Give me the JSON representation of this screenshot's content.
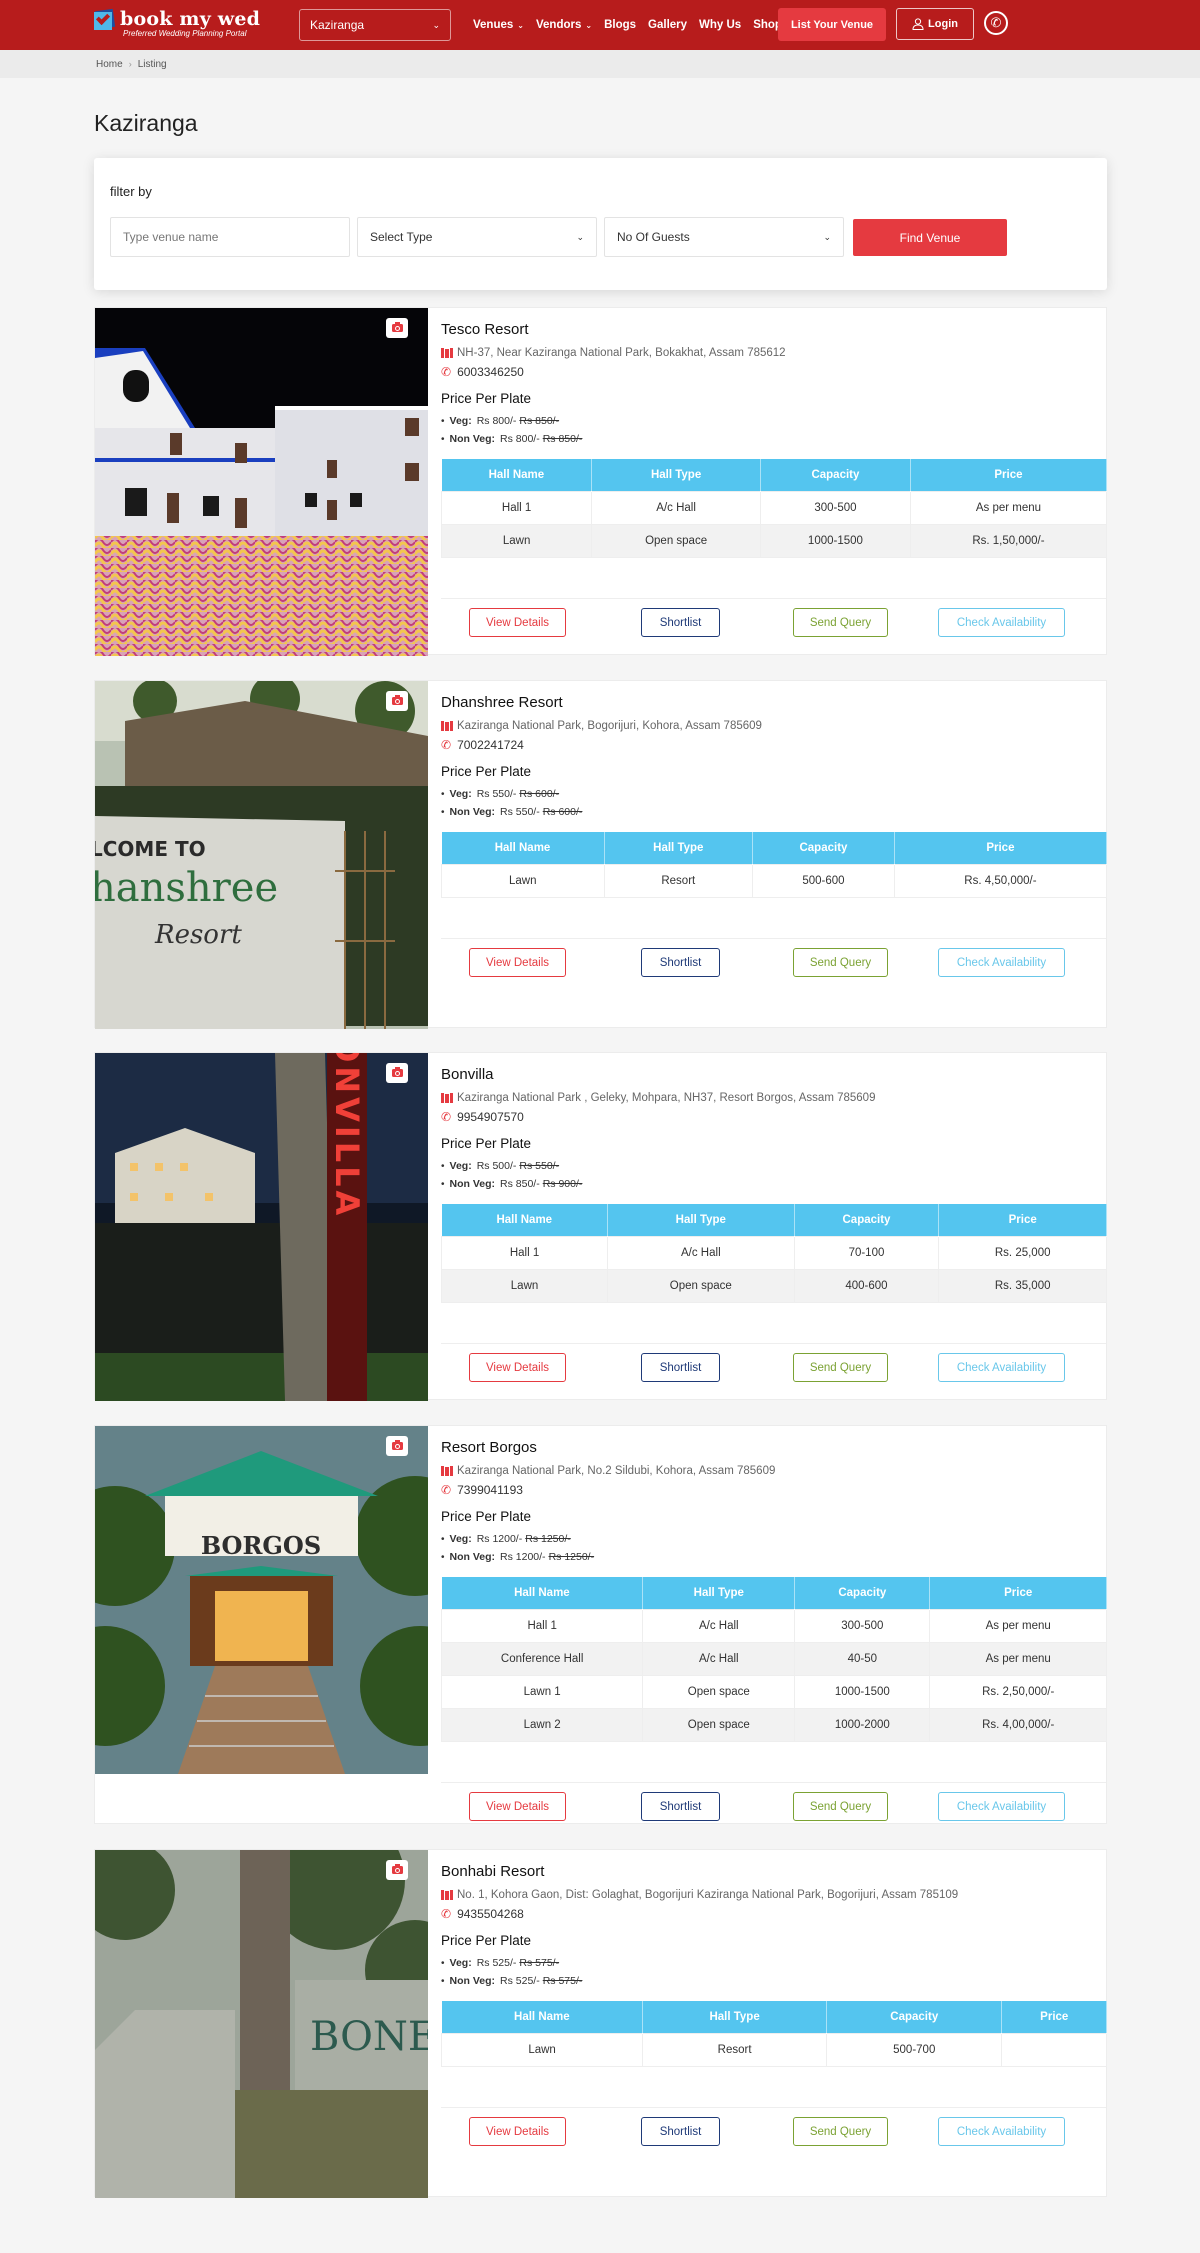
{
  "header": {
    "logo_title": "book my wed",
    "logo_tagline": "Preferred Wedding Planning Portal",
    "city_select": "Kaziranga",
    "nav": [
      {
        "label": "Venues",
        "dropdown": true
      },
      {
        "label": "Vendors",
        "dropdown": true
      },
      {
        "label": "Blogs",
        "dropdown": false
      },
      {
        "label": "Gallery",
        "dropdown": false
      },
      {
        "label": "Why Us",
        "dropdown": false
      },
      {
        "label": "Shop",
        "dropdown": false
      }
    ],
    "list_venue_label": "List Your Venue",
    "login_label": "Login",
    "icons": {
      "login": "user-icon",
      "phone": "phone-icon",
      "chevron": "chevron-down-icon"
    }
  },
  "breadcrumb": {
    "home": "Home",
    "separator": "›",
    "current": "Listing"
  },
  "page": {
    "title": "Kaziranga"
  },
  "filter": {
    "label": "filter by",
    "venue_placeholder": "Type venue name",
    "type_select": "Select Type",
    "guests_select": "No Of Guests",
    "find_label": "Find Venue"
  },
  "table_headers": [
    "Hall Name",
    "Hall Type",
    "Capacity",
    "Price"
  ],
  "price_heading": "Price Per Plate",
  "labels": {
    "veg": "Veg:",
    "nonveg": "Non Veg:"
  },
  "actions": {
    "view": "View Details",
    "shortlist": "Shortlist",
    "query": "Send Query",
    "availability": "Check Availability"
  },
  "colors": {
    "brand_red": "#b71c1c",
    "accent_red": "#e53a40",
    "table_header": "#54c5ef",
    "shortlist_navy": "#1f3a78",
    "query_green": "#7ba233",
    "avail_blue": "#69c7ea"
  },
  "listings": [
    {
      "name": "Tesco Resort",
      "address": "NH-37, Near Kaziranga National Park, Bokakhat, Assam 785612",
      "phone": "6003346250",
      "veg_price": "Rs 800/-",
      "veg_old": "Rs 850/-",
      "nonveg_price": "Rs 800/-",
      "nonveg_old": "Rs 850/-",
      "halls": [
        [
          "Hall 1",
          "A/c Hall",
          "300-500",
          "As per menu"
        ],
        [
          "Lawn",
          "Open space",
          "1000-1500",
          "Rs. 1,50,000/-"
        ]
      ]
    },
    {
      "name": "Dhanshree Resort",
      "address": "Kaziranga National Park, Bogorijuri, Kohora, Assam 785609",
      "phone": "7002241724",
      "veg_price": "Rs 550/-",
      "veg_old": "Rs 600/-",
      "nonveg_price": "Rs 550/-",
      "nonveg_old": "Rs 600/-",
      "image_sign": [
        "LCOME TO",
        "hanshree",
        "Resort"
      ],
      "halls": [
        [
          "Lawn",
          "Resort",
          "500-600",
          "Rs. 4,50,000/-"
        ]
      ]
    },
    {
      "name": "Bonvilla",
      "address": "Kaziranga National Park , Geleky, Mohpara, NH37, Resort Borgos, Assam 785609",
      "phone": "9954907570",
      "veg_price": "Rs 500/-",
      "veg_old": "Rs 550/-",
      "nonveg_price": "Rs 850/-",
      "nonveg_old": "Rs 900/-",
      "image_sign": "BONVILLA",
      "halls": [
        [
          "Hall 1",
          "A/c Hall",
          "70-100",
          "Rs. 25,000"
        ],
        [
          "Lawn",
          "Open space",
          "400-600",
          "Rs. 35,000"
        ]
      ]
    },
    {
      "name": "Resort Borgos",
      "address": "Kaziranga National Park, No.2 Sildubi, Kohora, Assam 785609",
      "phone": "7399041193",
      "veg_price": "Rs 1200/-",
      "veg_old": "Rs 1250/-",
      "nonveg_price": "Rs 1200/-",
      "nonveg_old": "Rs 1250/-",
      "image_sign": "BORGOS",
      "halls": [
        [
          "Hall 1",
          "A/c Hall",
          "300-500",
          "As per menu"
        ],
        [
          "Conference Hall",
          "A/c Hall",
          "40-50",
          "As per menu"
        ],
        [
          "Lawn 1",
          "Open space",
          "1000-1500",
          "Rs. 2,50,000/-"
        ],
        [
          "Lawn 2",
          "Open space",
          "1000-2000",
          "Rs. 4,00,000/-"
        ]
      ]
    },
    {
      "name": "Bonhabi Resort",
      "address": "No. 1, Kohora Gaon, Dist: Golaghat, Bogorijuri Kaziranga National Park, Bogorijuri, Assam 785109",
      "phone": "9435504268",
      "veg_price": "Rs 525/-",
      "veg_old": "Rs 575/-",
      "nonveg_price": "Rs 525/-",
      "nonveg_old": "Rs 575/-",
      "image_sign": "BONE",
      "halls": [
        [
          "Lawn",
          "Resort",
          "500-700",
          ""
        ]
      ]
    }
  ]
}
